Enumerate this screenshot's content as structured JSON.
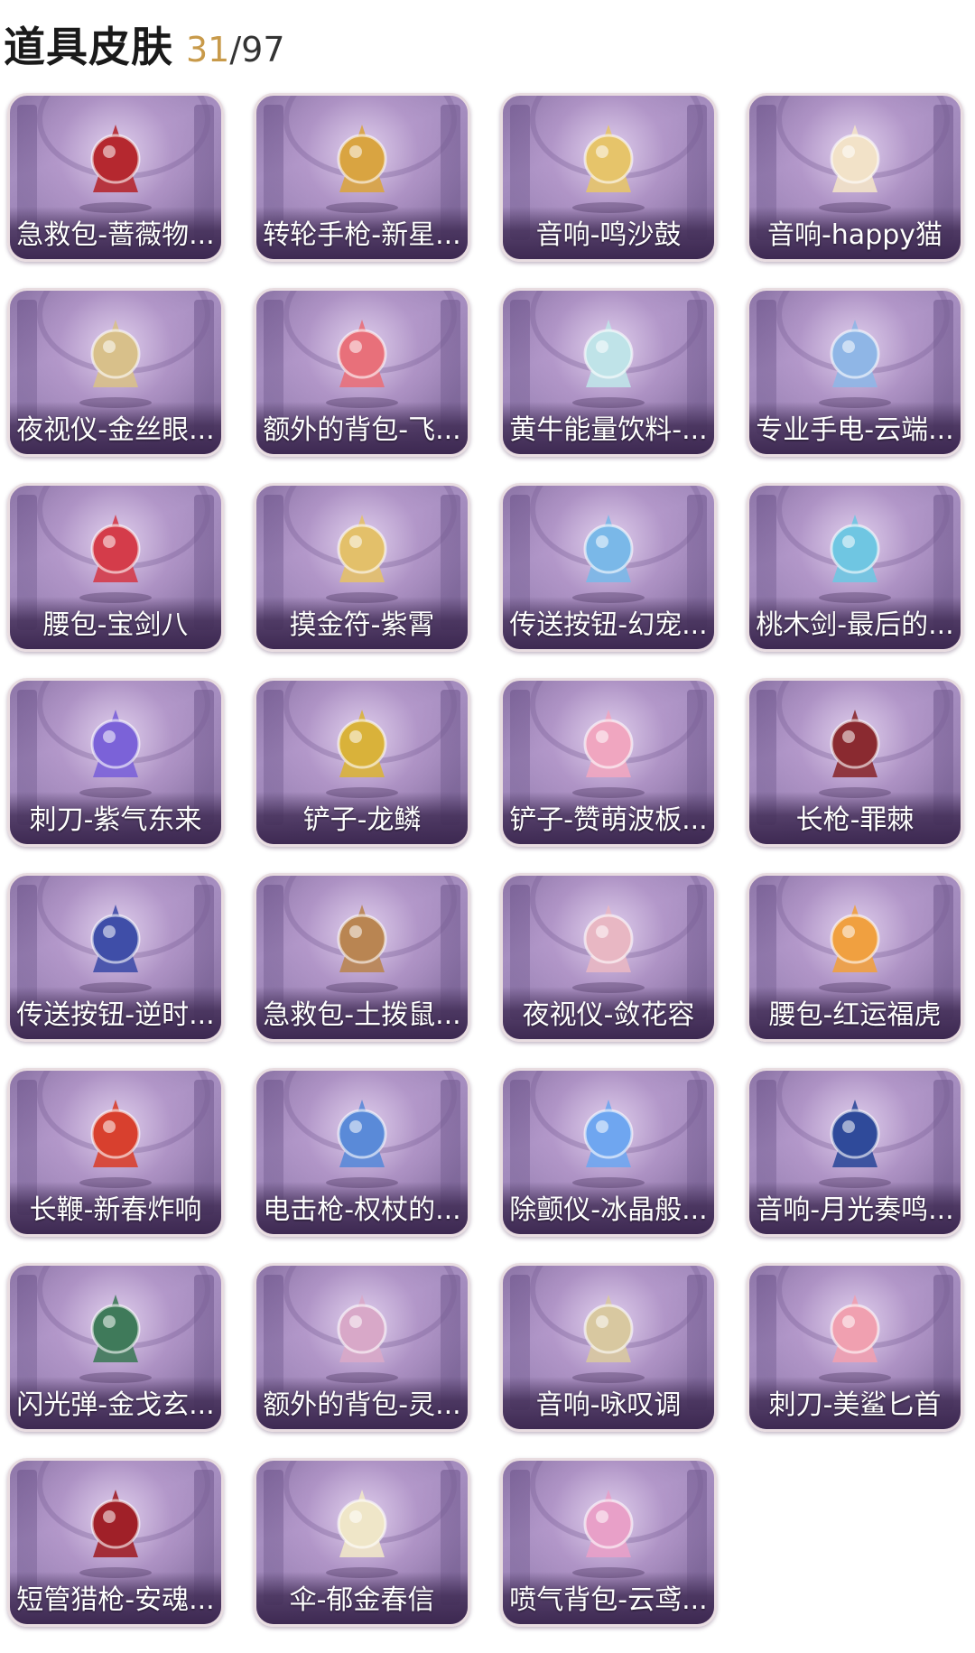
{
  "header": {
    "title": "道具皮肤",
    "owned": "31",
    "total_sep": "/97"
  },
  "items": [
    {
      "label": "急救包-蔷薇物...",
      "icon": "medkit-icon",
      "color": "#b5282f"
    },
    {
      "label": "转轮手枪-新星...",
      "icon": "revolver-icon",
      "color": "#d9a441"
    },
    {
      "label": "音响-鸣沙鼓",
      "icon": "drum-icon",
      "color": "#e6c46a"
    },
    {
      "label": "音响-happy猫",
      "icon": "cat-figure-icon",
      "color": "#f2e2c8"
    },
    {
      "label": "夜视仪-金丝眼...",
      "icon": "glasses-icon",
      "color": "#d8c08a"
    },
    {
      "label": "额外的背包-飞...",
      "icon": "flower-backpack-icon",
      "color": "#e8707a"
    },
    {
      "label": "黄牛能量饮料-...",
      "icon": "bottle-icon",
      "color": "#bfe3e8"
    },
    {
      "label": "专业手电-云端...",
      "icon": "flashlight-icon",
      "color": "#8fb6e6"
    },
    {
      "label": "腰包-宝剑八",
      "icon": "heart-pouch-icon",
      "color": "#d43c4a"
    },
    {
      "label": "摸金符-紫霄",
      "icon": "amulet-icon",
      "color": "#e3c06a"
    },
    {
      "label": "传送按钮-幻宠...",
      "icon": "device-icon",
      "color": "#7ab8e8"
    },
    {
      "label": "桃木剑-最后的...",
      "icon": "sword-icon",
      "color": "#6fc6e2"
    },
    {
      "label": "刺刀-紫气东来",
      "icon": "blade-icon",
      "color": "#7b62d8"
    },
    {
      "label": "铲子-龙鳞",
      "icon": "shovel-icon",
      "color": "#d9b23a"
    },
    {
      "label": "铲子-赞萌波板...",
      "icon": "pink-shovel-icon",
      "color": "#f0a6c0"
    },
    {
      "label": "长枪-罪棘",
      "icon": "spear-icon",
      "color": "#8a2a30"
    },
    {
      "label": "传送按钮-逆时...",
      "icon": "pocket-watch-icon",
      "color": "#3f4ea8"
    },
    {
      "label": "急救包-土拨鼠...",
      "icon": "hamster-icon",
      "color": "#b98552"
    },
    {
      "label": "夜视仪-敛花容",
      "icon": "flower-goggles-icon",
      "color": "#e8b7c3"
    },
    {
      "label": "腰包-红运福虎",
      "icon": "tiger-pouch-icon",
      "color": "#f0a040"
    },
    {
      "label": "长鞭-新春炸响",
      "icon": "firecracker-whip-icon",
      "color": "#d8402e"
    },
    {
      "label": "电击枪-权杖的...",
      "icon": "scepter-icon",
      "color": "#5a8ad8"
    },
    {
      "label": "除颤仪-冰晶般...",
      "icon": "ice-lotus-icon",
      "color": "#6fa6f0"
    },
    {
      "label": "音响-月光奏鸣...",
      "icon": "piano-icon",
      "color": "#2f4a9a"
    },
    {
      "label": "闪光弹-金戈玄...",
      "icon": "grenade-icon",
      "color": "#3f7a5a"
    },
    {
      "label": "额外的背包-灵...",
      "icon": "bouquet-icon",
      "color": "#d8a8c8"
    },
    {
      "label": "音响-咏叹调",
      "icon": "birdcage-icon",
      "color": "#d8c8a0"
    },
    {
      "label": "刺刀-美鲨匕首",
      "icon": "shark-dagger-icon",
      "color": "#f0a0b0"
    },
    {
      "label": "短管猎枪-安魂...",
      "icon": "shotgun-icon",
      "color": "#a02028"
    },
    {
      "label": "伞-郁金春信",
      "icon": "umbrella-icon",
      "color": "#efe6c8"
    },
    {
      "label": "喷气背包-云鸢...",
      "icon": "kite-jetpack-icon",
      "color": "#e8a0c8"
    }
  ]
}
